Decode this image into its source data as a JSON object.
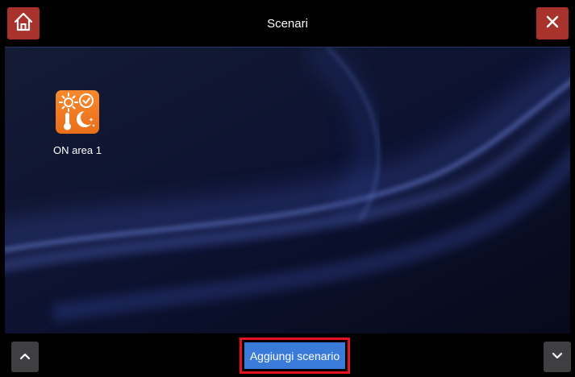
{
  "header": {
    "title": "Scenari",
    "home_icon": "home-icon",
    "close_icon": "close-icon",
    "accent_color": "#a8322c"
  },
  "scenarios": [
    {
      "label": "ON area 1",
      "icon": "climate-schedule-icon",
      "icon_color": "#f6892e"
    }
  ],
  "footer": {
    "add_label": "Aggiungi scenario",
    "up_icon": "chevron-up-icon",
    "down_icon": "chevron-down-icon",
    "add_button_color": "#3a7ad9",
    "highlight_color": "#e8121d"
  }
}
